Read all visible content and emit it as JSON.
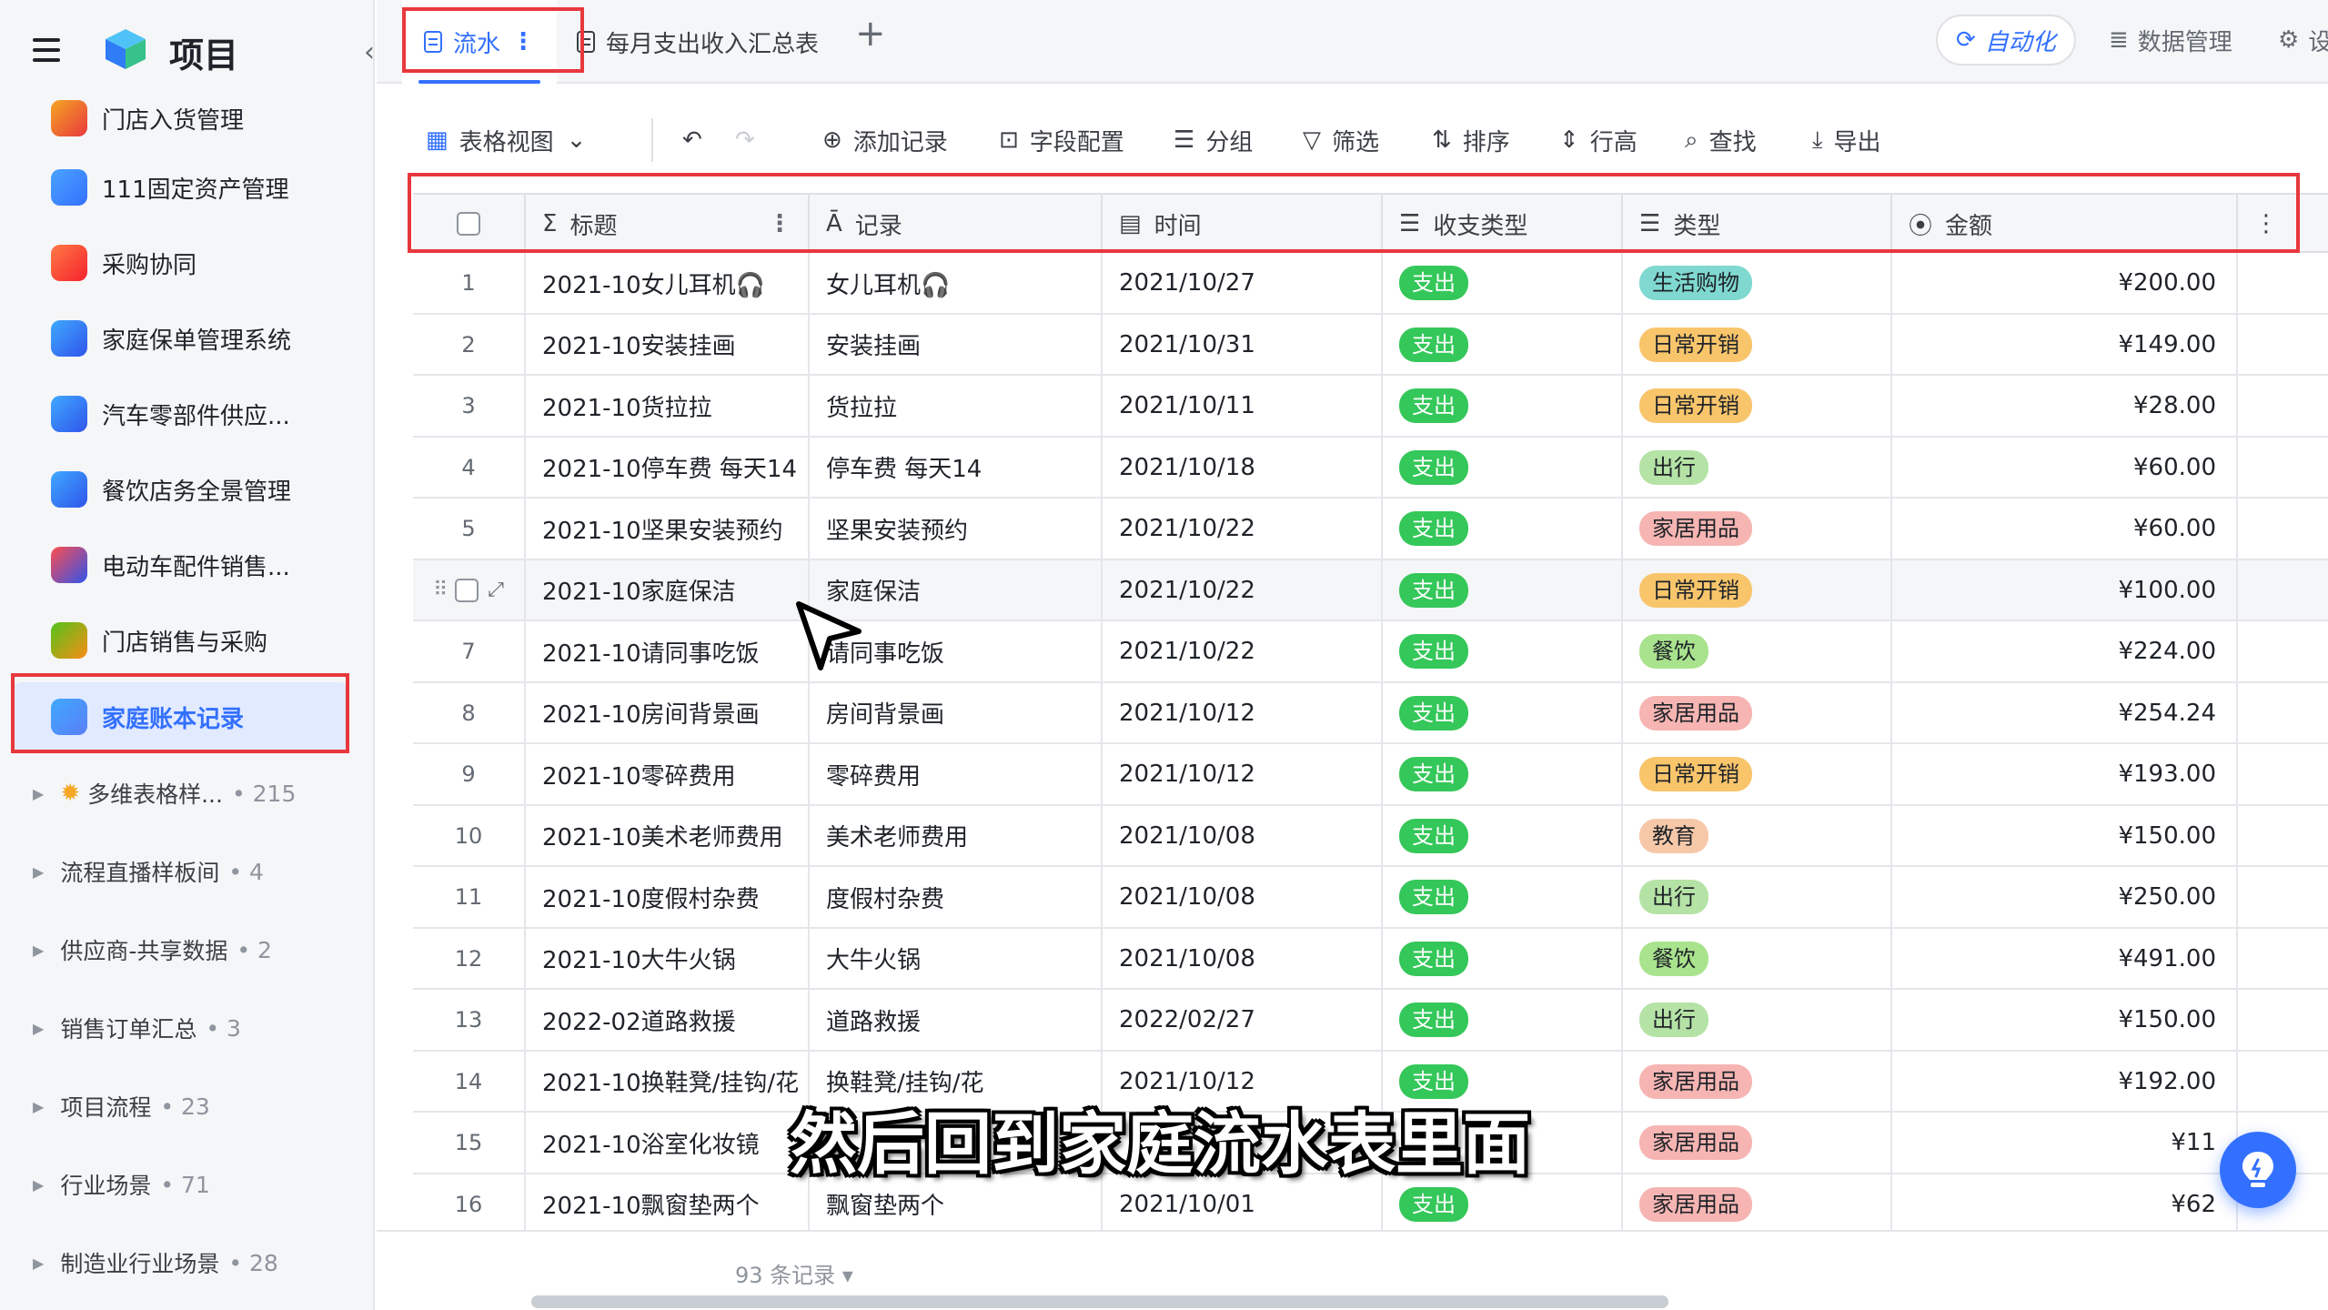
{
  "app": {
    "title": "项目"
  },
  "sidebar": {
    "items": [
      {
        "label": "门店入货管理",
        "color_a": "#f5a623",
        "color_b": "#e8383d"
      },
      {
        "label": "111固定资产管理",
        "color_a": "#4aa3ff",
        "color_b": "#3370ff"
      },
      {
        "label": "采购协同",
        "color_a": "#ff7a45",
        "color_b": "#f5222d"
      },
      {
        "label": "家庭保单管理系统",
        "color_a": "#40a9ff",
        "color_b": "#2f54eb"
      },
      {
        "label": "汽车零部件供应...",
        "color_a": "#40a9ff",
        "color_b": "#2f54eb"
      },
      {
        "label": "餐饮店务全景管理",
        "color_a": "#40a9ff",
        "color_b": "#2f54eb"
      },
      {
        "label": "电动车配件销售...",
        "color_a": "#ff4d4f",
        "color_b": "#2f54eb"
      },
      {
        "label": "门店销售与采购",
        "color_a": "#52c41a",
        "color_b": "#fa8c16"
      },
      {
        "label": "家庭账本记录",
        "color_a": "#40a9ff",
        "color_b": "#597ef7"
      }
    ],
    "active_index": 8,
    "folders": [
      {
        "label": "多维表格样...",
        "count": "• 215",
        "has_sun": true
      },
      {
        "label": "流程直播样板间",
        "count": "• 4"
      },
      {
        "label": "供应商-共享数据",
        "count": "• 2"
      },
      {
        "label": "销售订单汇总",
        "count": "• 3"
      },
      {
        "label": "项目流程",
        "count": "• 23"
      },
      {
        "label": "行业场景",
        "count": "• 71"
      },
      {
        "label": "制造业行业场景",
        "count": "• 28"
      }
    ]
  },
  "tabs": {
    "active": "流水",
    "second": "每月支出收入汇总表"
  },
  "header_right": {
    "automation": "自动化",
    "data_manage": "数据管理",
    "settings": "设"
  },
  "toolbar": {
    "view": "表格视图",
    "add_record": "添加记录",
    "field_config": "字段配置",
    "group": "分组",
    "filter": "筛选",
    "sort": "排序",
    "row_height": "行高",
    "find": "查找",
    "export": "导出"
  },
  "columns": {
    "title": "标题",
    "record": "记录",
    "time": "时间",
    "income_type": "收支类型",
    "category": "类型",
    "amount": "金额"
  },
  "tag_colors": {
    "生活购物": "#7fd9d0",
    "日常开销": "#f8c56b",
    "出行": "#b5e3a6",
    "家居用品": "#f6b5b2",
    "餐饮": "#a9e38d",
    "教育": "#f7c8a8"
  },
  "rows": [
    {
      "n": "1",
      "title": "2021-10女儿耳机🎧",
      "record": "女儿耳机🎧",
      "time": "2021/10/27",
      "type": "支出",
      "cat": "生活购物",
      "amount": "¥200.00"
    },
    {
      "n": "2",
      "title": "2021-10安装挂画",
      "record": "安装挂画",
      "time": "2021/10/31",
      "type": "支出",
      "cat": "日常开销",
      "amount": "¥149.00"
    },
    {
      "n": "3",
      "title": "2021-10货拉拉",
      "record": "货拉拉",
      "time": "2021/10/11",
      "type": "支出",
      "cat": "日常开销",
      "amount": "¥28.00"
    },
    {
      "n": "4",
      "title": "2021-10停车费 每天14",
      "record": "停车费 每天14",
      "time": "2021/10/18",
      "type": "支出",
      "cat": "出行",
      "amount": "¥60.00"
    },
    {
      "n": "5",
      "title": "2021-10坚果安装预约",
      "record": "坚果安装预约",
      "time": "2021/10/22",
      "type": "支出",
      "cat": "家居用品",
      "amount": "¥60.00"
    },
    {
      "n": "",
      "title": "2021-10家庭保洁",
      "record": "家庭保洁",
      "time": "2021/10/22",
      "type": "支出",
      "cat": "日常开销",
      "amount": "¥100.00"
    },
    {
      "n": "7",
      "title": "2021-10请同事吃饭",
      "record": "请同事吃饭",
      "time": "2021/10/22",
      "type": "支出",
      "cat": "餐饮",
      "amount": "¥224.00"
    },
    {
      "n": "8",
      "title": "2021-10房间背景画",
      "record": "房间背景画",
      "time": "2021/10/12",
      "type": "支出",
      "cat": "家居用品",
      "amount": "¥254.24"
    },
    {
      "n": "9",
      "title": "2021-10零碎费用",
      "record": "零碎费用",
      "time": "2021/10/12",
      "type": "支出",
      "cat": "日常开销",
      "amount": "¥193.00"
    },
    {
      "n": "10",
      "title": "2021-10美术老师费用",
      "record": "美术老师费用",
      "time": "2021/10/08",
      "type": "支出",
      "cat": "教育",
      "amount": "¥150.00"
    },
    {
      "n": "11",
      "title": "2021-10度假村杂费",
      "record": "度假村杂费",
      "time": "2021/10/08",
      "type": "支出",
      "cat": "出行",
      "amount": "¥250.00"
    },
    {
      "n": "12",
      "title": "2021-10大牛火锅",
      "record": "大牛火锅",
      "time": "2021/10/08",
      "type": "支出",
      "cat": "餐饮",
      "amount": "¥491.00"
    },
    {
      "n": "13",
      "title": "2022-02道路救援",
      "record": "道路救援",
      "time": "2022/02/27",
      "type": "支出",
      "cat": "出行",
      "amount": "¥150.00"
    },
    {
      "n": "14",
      "title": "2021-10换鞋凳/挂钩/花",
      "record": "换鞋凳/挂钩/花",
      "time": "2021/10/12",
      "type": "支出",
      "cat": "家居用品",
      "amount": "¥192.00"
    },
    {
      "n": "15",
      "title": "2021-10浴室化妆镜",
      "record": "",
      "time": "",
      "type": "",
      "cat": "家居用品",
      "amount": "¥11"
    },
    {
      "n": "16",
      "title": "2021-10飘窗垫两个",
      "record": "飘窗垫两个",
      "time": "2021/10/01",
      "type": "支出",
      "cat": "家居用品",
      "amount": "¥62"
    }
  ],
  "hover_row_index": 5,
  "footer": {
    "record_count": "93 条记录 ▾"
  },
  "subtitle": "然后回到家庭流水表里面",
  "accent": "#3370ff",
  "highlight": "#e8383d"
}
